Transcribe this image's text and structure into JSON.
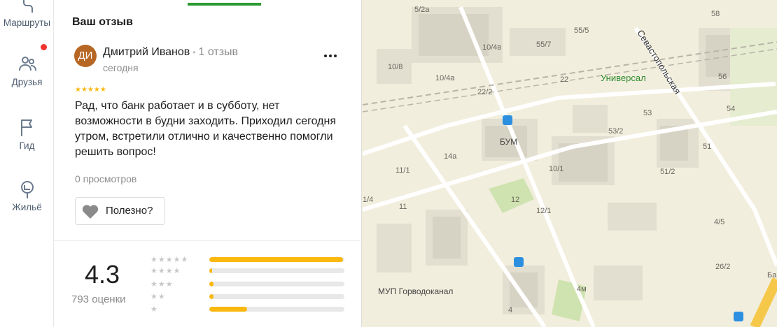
{
  "rail": {
    "items": [
      {
        "label": "Маршруты",
        "icon": "routes-icon"
      },
      {
        "label": "Друзья",
        "icon": "friends-icon"
      },
      {
        "label": "Гид",
        "icon": "flag-icon"
      },
      {
        "label": "Жильё",
        "icon": "housing-icon"
      }
    ]
  },
  "panel": {
    "section_title": "Ваш отзыв",
    "review": {
      "avatar_initials": "ДИ",
      "author": "Дмитрий Иванов",
      "author_reviews": "1 отзыв",
      "date": "сегодня",
      "rating": 5,
      "stars": "★★★★★",
      "text": "Рад, что банк работает и в субботу, нет возможности в будни заходить. Приходил сегодня утром, встретили отлично и качественно помогли решить вопрос!",
      "views": "0 просмотров",
      "useful_label": "Полезно?"
    },
    "summary": {
      "rating": "4.3",
      "count": "793 оценки",
      "distribution": [
        {
          "stars": "★★★★★",
          "fraction": 0.99
        },
        {
          "stars": "★★★★",
          "fraction": 0.02
        },
        {
          "stars": "★★★",
          "fraction": 0.03
        },
        {
          "stars": "★★",
          "fraction": 0.03
        },
        {
          "stars": "★",
          "fraction": 0.28
        }
      ]
    }
  },
  "map": {
    "labels": [
      "5/2а",
      "58",
      "55/5",
      "10/4в",
      "55/7",
      "10/8",
      "10/4а",
      "22",
      "22/2",
      "56",
      "54",
      "53",
      "53/2",
      "БУМ",
      "14а",
      "51",
      "11/1",
      "10/1",
      "51/2",
      "1/4",
      "12",
      "11",
      "12/1",
      "4/5",
      "26/2",
      "МУП Горводоканал",
      "4м",
      "4",
      "Ба"
    ],
    "poi": "Универсал",
    "street": "Севастопольская"
  },
  "colors": {
    "accent_green": "#2b9a32",
    "star": "#fbb80f",
    "avatar": "#b66724",
    "badge": "#f0322d"
  }
}
